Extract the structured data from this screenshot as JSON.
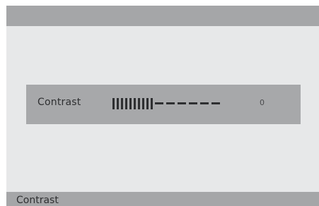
{
  "osd": {
    "label": "Contrast",
    "value": "0",
    "level_filled_segments": 10,
    "level_empty_segments": 6
  },
  "status": {
    "label": "Contrast"
  },
  "colors": {
    "screen_background": "#e7e8e9",
    "bar_background": "#a5a6a8",
    "text": "#2f3032"
  }
}
